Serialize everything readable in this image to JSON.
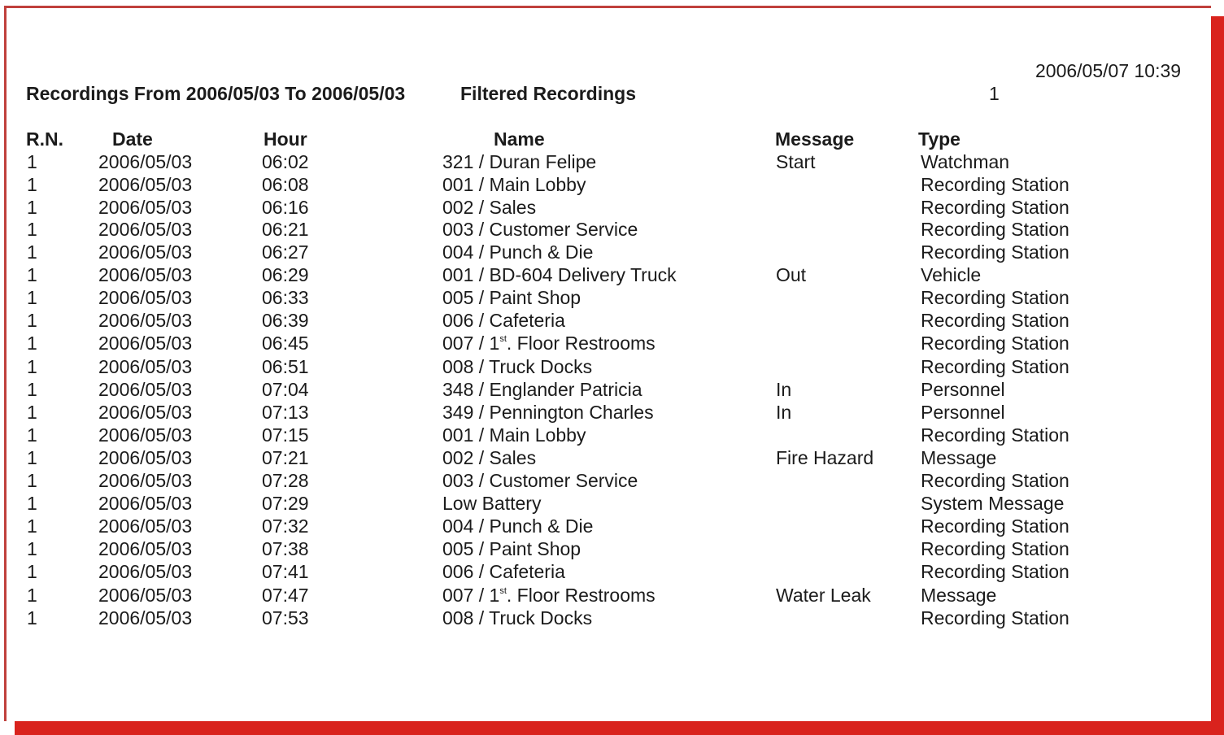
{
  "report": {
    "printed_at": "2006/05/07 10:39",
    "title": "Recordings From 2006/05/03 To 2006/05/03",
    "filtered_label": "Filtered Recordings",
    "filtered_count": "1"
  },
  "columns": {
    "rn": "R.N.",
    "date": "Date",
    "hour": "Hour",
    "name": "Name",
    "message": "Message",
    "type": "Type"
  },
  "rows": [
    {
      "rn": "1",
      "date": "2006/05/03",
      "hour": "06:02",
      "name": "321 / Duran Felipe",
      "message": "Start",
      "type": "Watchman"
    },
    {
      "rn": "1",
      "date": "2006/05/03",
      "hour": "06:08",
      "name": "001 / Main Lobby",
      "message": "",
      "type": "Recording Station"
    },
    {
      "rn": "1",
      "date": "2006/05/03",
      "hour": "06:16",
      "name": "002 / Sales",
      "message": "",
      "type": "Recording Station"
    },
    {
      "rn": "1",
      "date": "2006/05/03",
      "hour": "06:21",
      "name": "003 / Customer Service",
      "message": "",
      "type": "Recording Station"
    },
    {
      "rn": "1",
      "date": "2006/05/03",
      "hour": "06:27",
      "name": "004 / Punch & Die",
      "message": "",
      "type": "Recording Station"
    },
    {
      "rn": "1",
      "date": "2006/05/03",
      "hour": "06:29",
      "name": "001 / BD-604 Delivery Truck",
      "message": "Out",
      "type": "Vehicle"
    },
    {
      "rn": "1",
      "date": "2006/05/03",
      "hour": "06:33",
      "name": "005 / Paint Shop",
      "message": "",
      "type": "Recording Station"
    },
    {
      "rn": "1",
      "date": "2006/05/03",
      "hour": "06:39",
      "name": "006 / Cafeteria",
      "message": "",
      "type": "Recording Station"
    },
    {
      "rn": "1",
      "date": "2006/05/03",
      "hour": "06:45",
      "name_prefix": "007 / 1",
      "name_sup": "st",
      "name_suffix": ". Floor Restrooms",
      "message": "",
      "type": "Recording Station"
    },
    {
      "rn": "1",
      "date": "2006/05/03",
      "hour": "06:51",
      "name": "008 / Truck Docks",
      "message": "",
      "type": "Recording Station"
    },
    {
      "rn": "1",
      "date": "2006/05/03",
      "hour": "07:04",
      "name": "348 / Englander Patricia",
      "message": "In",
      "type": "Personnel"
    },
    {
      "rn": "1",
      "date": "2006/05/03",
      "hour": "07:13",
      "name": "349 / Pennington Charles",
      "message": "In",
      "type": "Personnel"
    },
    {
      "rn": "1",
      "date": "2006/05/03",
      "hour": "07:15",
      "name": "001 / Main Lobby",
      "message": "",
      "type": "Recording Station"
    },
    {
      "rn": "1",
      "date": "2006/05/03",
      "hour": "07:21",
      "name": "002 / Sales",
      "message": "Fire Hazard",
      "type": "Message"
    },
    {
      "rn": "1",
      "date": "2006/05/03",
      "hour": "07:28",
      "name": "003 / Customer Service",
      "message": "",
      "type": "Recording Station"
    },
    {
      "rn": "1",
      "date": "2006/05/03",
      "hour": "07:29",
      "name": "Low Battery",
      "message": "",
      "type": "System Message"
    },
    {
      "rn": "1",
      "date": "2006/05/03",
      "hour": "07:32",
      "name": "004 / Punch & Die",
      "message": "",
      "type": "Recording Station"
    },
    {
      "rn": "1",
      "date": "2006/05/03",
      "hour": "07:38",
      "name": "005 / Paint Shop",
      "message": "",
      "type": "Recording Station"
    },
    {
      "rn": "1",
      "date": "2006/05/03",
      "hour": "07:41",
      "name": "006 / Cafeteria",
      "message": "",
      "type": "Recording Station"
    },
    {
      "rn": "1",
      "date": "2006/05/03",
      "hour": "07:47",
      "name_prefix": "007 / 1",
      "name_sup": "st",
      "name_suffix": ". Floor Restrooms",
      "message": "Water Leak",
      "type": "Message"
    },
    {
      "rn": "1",
      "date": "2006/05/03",
      "hour": "07:53",
      "name": "008 / Truck Docks",
      "message": "",
      "type": "Recording Station"
    }
  ]
}
